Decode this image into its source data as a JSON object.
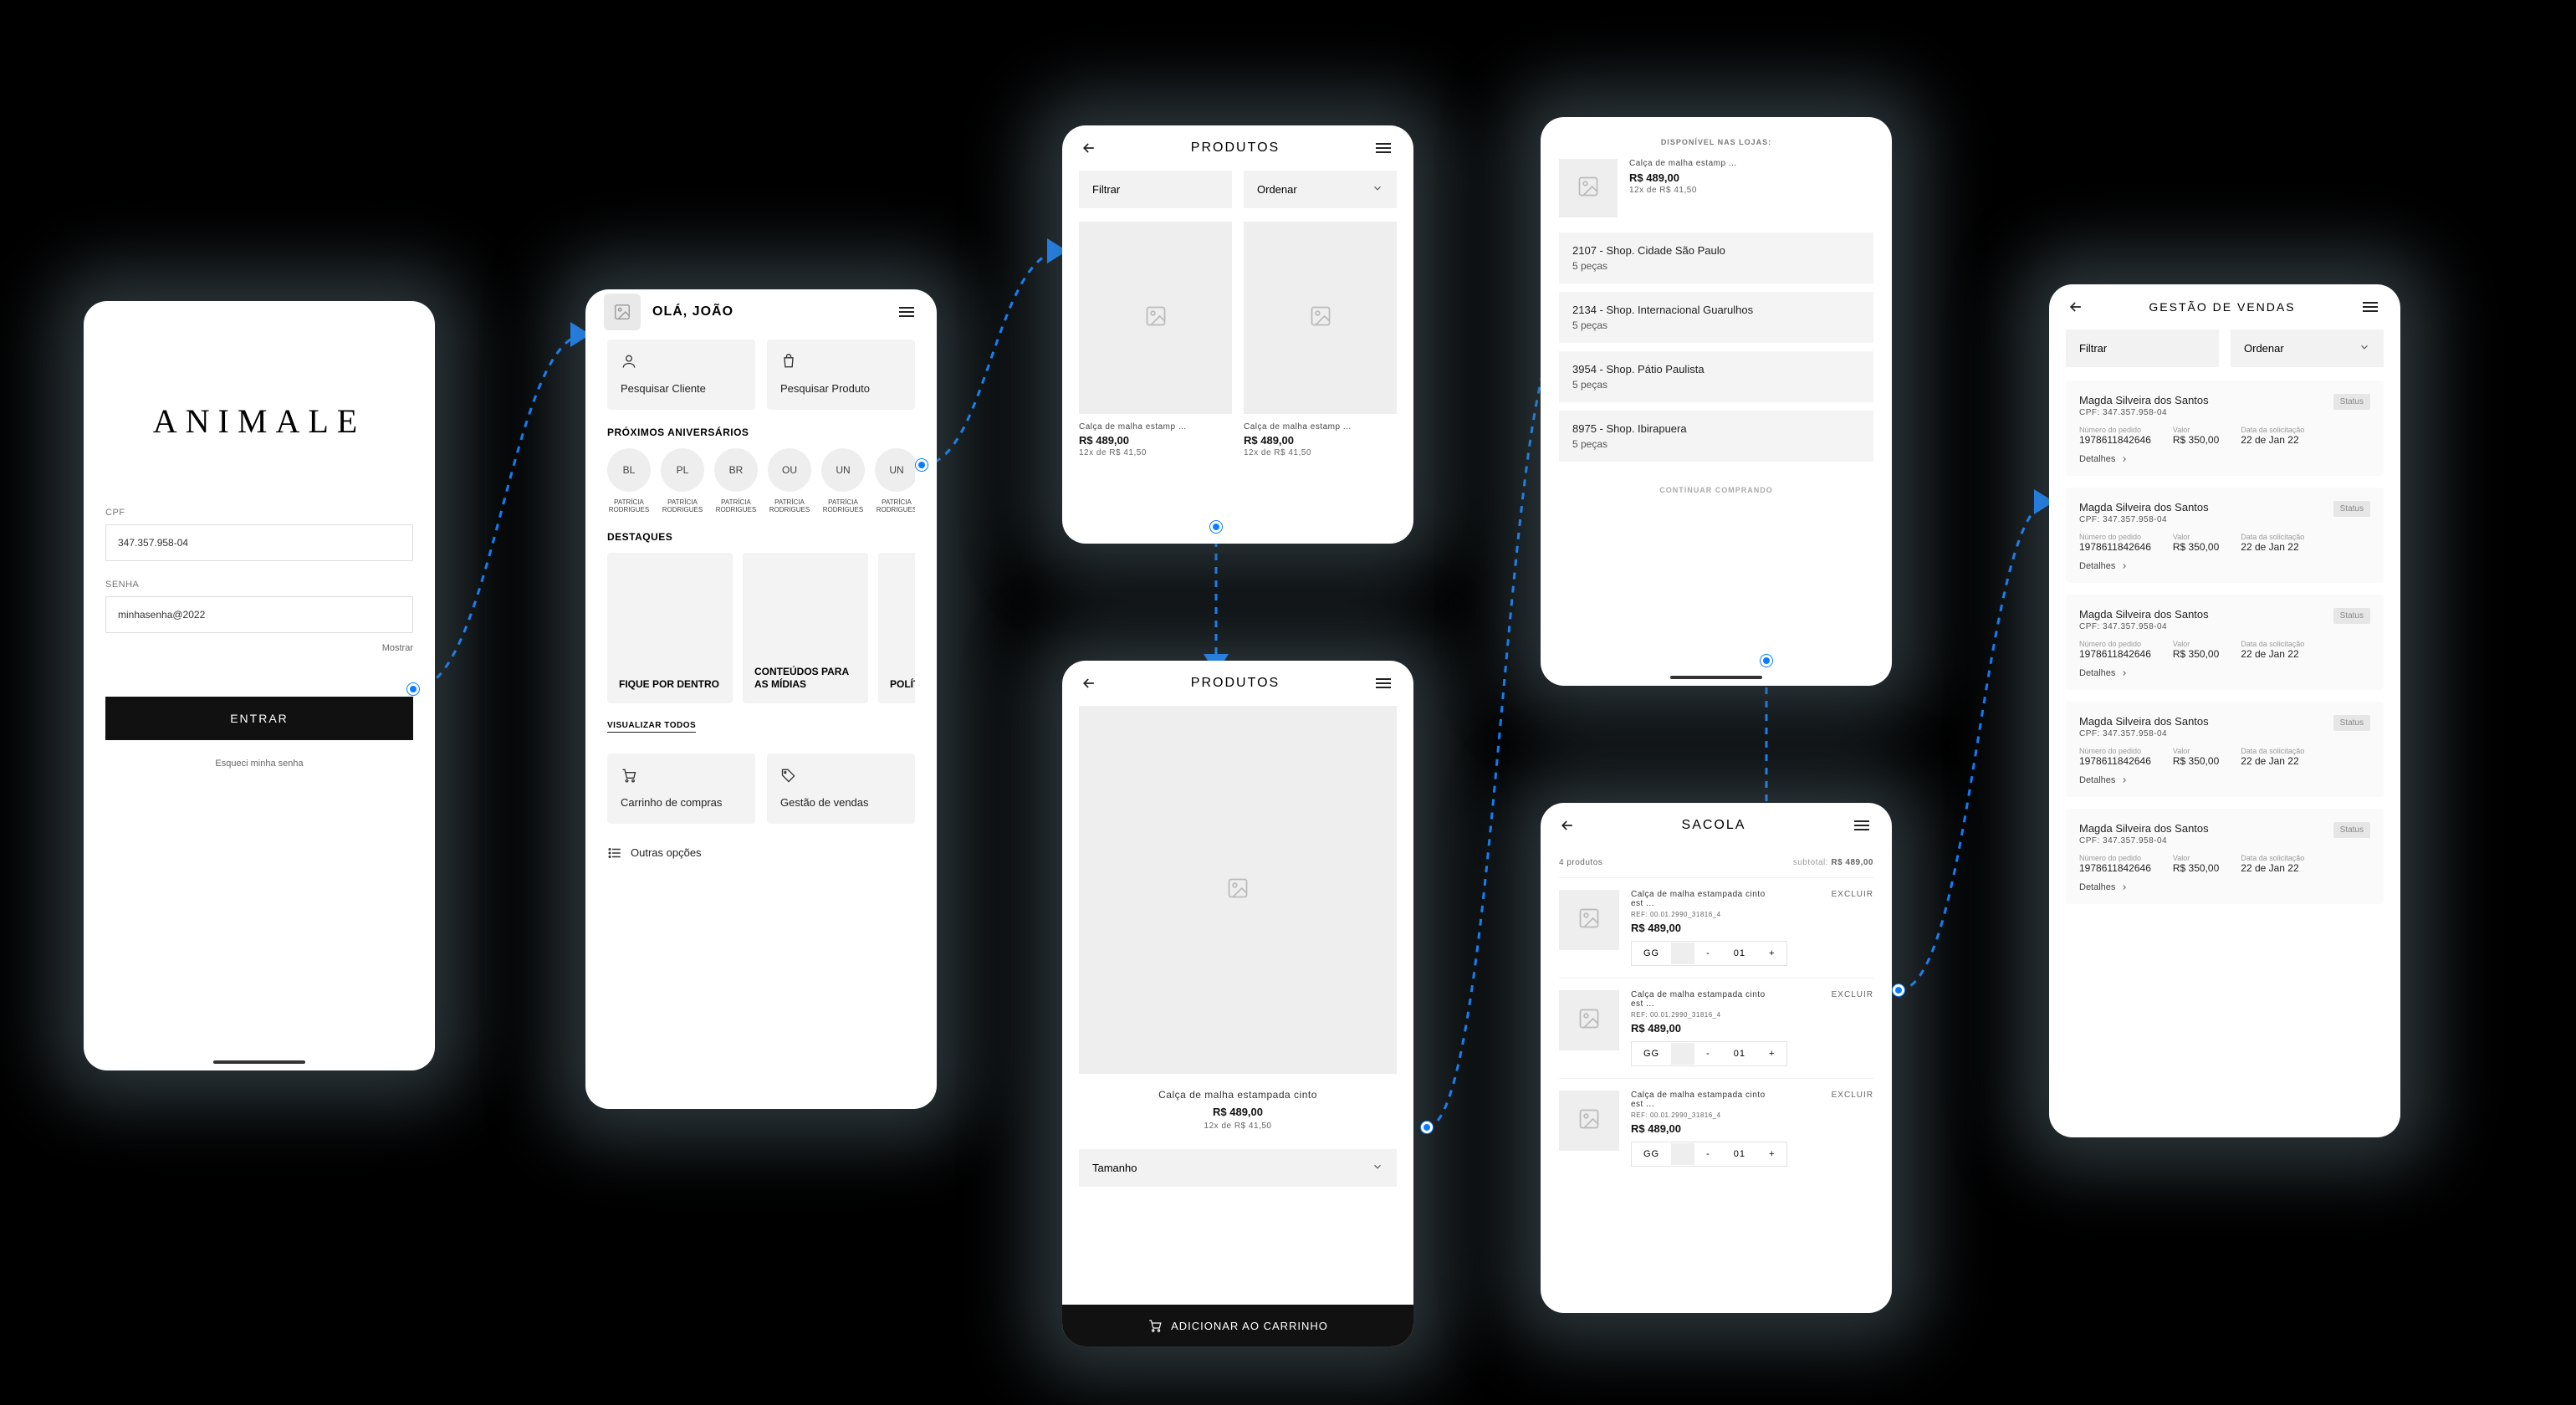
{
  "login": {
    "brand": "ANIMALE",
    "cpf_label": "CPF",
    "cpf_value": "347.357.958-04",
    "senha_label": "SENHA",
    "senha_value": "minhasenha@2022",
    "mostrar": "Mostrar",
    "entrar": "ENTRAR",
    "esqueci": "Esqueci minha senha"
  },
  "home": {
    "greeting": "OLÁ, JOÃO",
    "search_client": "Pesquisar Cliente",
    "search_product": "Pesquisar Produto",
    "birthdays_title": "PRÓXIMOS ANIVERSÁRIOS",
    "chips": [
      {
        "code": "BL",
        "name": "PATRÍCIA RODRIGUES"
      },
      {
        "code": "PL",
        "name": "PATRÍCIA RODRIGUES"
      },
      {
        "code": "BR",
        "name": "PATRÍCIA RODRIGUES"
      },
      {
        "code": "OU",
        "name": "PATRÍCIA RODRIGUES"
      },
      {
        "code": "UN",
        "name": "PATRÍCIA RODRIGUES"
      },
      {
        "code": "UN",
        "name": "PATRÍCIA RODRIGUES"
      }
    ],
    "destaques_title": "DESTAQUES",
    "destaques": [
      "FIQUE POR DENTRO",
      "CONTEÚDOS PARA AS MÍDIAS",
      "POLÍT. INTER"
    ],
    "visualizar_todos": "VISUALIZAR TODOS",
    "carrinho": "Carrinho de compras",
    "gestao": "Gestão de vendas",
    "outras": "Outras opções"
  },
  "product_list": {
    "title": "PRODUTOS",
    "filtrar": "Filtrar",
    "ordenar": "Ordenar",
    "items": [
      {
        "name": "Calça de malha estamp ...",
        "price": "R$ 489,00",
        "inst": "12x de R$ 41,50"
      },
      {
        "name": "Calça de malha estamp ...",
        "price": "R$ 489,00",
        "inst": "12x de R$ 41,50"
      }
    ]
  },
  "product_detail": {
    "title": "PRODUTOS",
    "name": "Calça de malha estampada cinto",
    "price": "R$ 489,00",
    "inst": "12x de R$ 41,50",
    "tamanho": "Tamanho",
    "add": "ADICIONAR AO CARRINHO"
  },
  "stores": {
    "title": "DISPONÍVEL NAS LOJAS:",
    "item": {
      "name": "Calça de malha estamp ...",
      "price": "R$ 489,00",
      "inst": "12x de R$ 41,50"
    },
    "list": [
      {
        "name": "2107 - Shop. Cidade São Paulo",
        "qty": "5 peças"
      },
      {
        "name": "2134 - Shop. Internacional Guarulhos",
        "qty": "5 peças"
      },
      {
        "name": "3954 - Shop. Pátio Paulista",
        "qty": "5 peças"
      },
      {
        "name": "8975 - Shop. Ibirapuera",
        "qty": "5 peças"
      }
    ],
    "continuar": "CONTINUAR COMPRANDO"
  },
  "bag": {
    "title": "SACOLA",
    "count_label": "4 produtos",
    "subtotal_label": "subtotal:",
    "subtotal_value": "R$ 489,00",
    "excluir": "EXCLUIR",
    "items": [
      {
        "name": "Calça de malha estampada cinto est ...",
        "ref": "REF: 00.01.2990_31816_4",
        "price": "R$ 489,00",
        "size": "GG",
        "qty": "01"
      },
      {
        "name": "Calça de malha estampada cinto est ...",
        "ref": "REF: 00.01.2990_31816_4",
        "price": "R$ 489,00",
        "size": "GG",
        "qty": "01"
      },
      {
        "name": "Calça de malha estampada cinto est ...",
        "ref": "REF: 00.01.2990_31816_4",
        "price": "R$ 489,00",
        "size": "GG",
        "qty": "01"
      }
    ]
  },
  "sales": {
    "title": "GESTÃO DE VENDAS",
    "filtrar": "Filtrar",
    "ordenar": "Ordenar",
    "status": "Status",
    "num_label": "Número do pedido",
    "valor_label": "Valor",
    "data_label": "Data da solicitação",
    "detalhes": "Detalhes",
    "orders": [
      {
        "name": "Magda Silveira dos Santos",
        "cpf": "CPF: 347.357.958-04",
        "num": "1978611842646",
        "valor": "R$ 350,00",
        "data": "22 de Jan 22"
      },
      {
        "name": "Magda Silveira dos Santos",
        "cpf": "CPF: 347.357.958-04",
        "num": "1978611842646",
        "valor": "R$ 350,00",
        "data": "22 de Jan 22"
      },
      {
        "name": "Magda Silveira dos Santos",
        "cpf": "CPF: 347.357.958-04",
        "num": "1978611842646",
        "valor": "R$ 350,00",
        "data": "22 de Jan 22"
      },
      {
        "name": "Magda Silveira dos Santos",
        "cpf": "CPF: 347.357.958-04",
        "num": "1978611842646",
        "valor": "R$ 350,00",
        "data": "22 de Jan 22"
      },
      {
        "name": "Magda Silveira dos Santos",
        "cpf": "CPF: 347.357.958-04",
        "num": "1978611842646",
        "valor": "R$ 350,00",
        "data": "22 de Jan 22"
      }
    ]
  }
}
